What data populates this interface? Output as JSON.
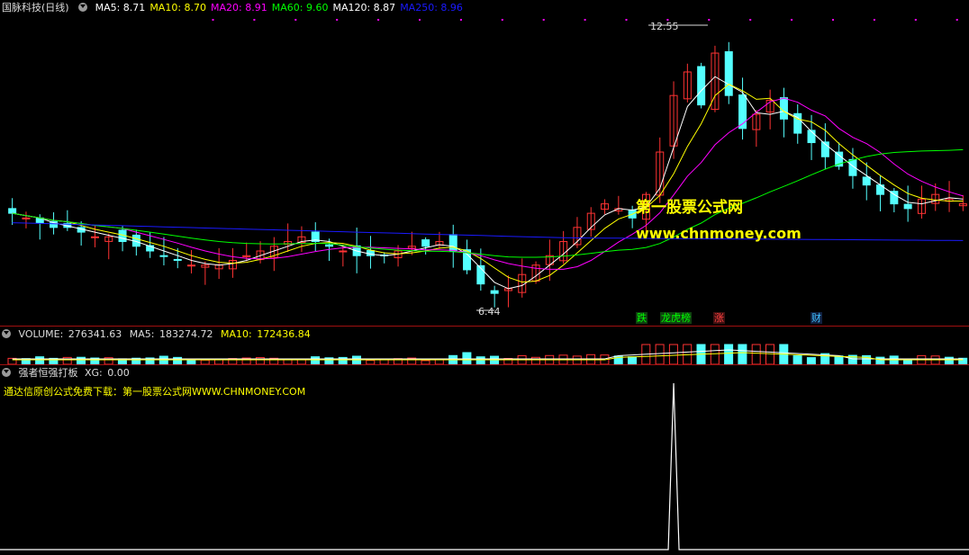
{
  "main_pane": {
    "title": "国脉科技(日线)",
    "ma": [
      {
        "label": "MA5:",
        "value": "8.71",
        "color": "#ffffff"
      },
      {
        "label": "MA10:",
        "value": "8.70",
        "color": "#ffff00"
      },
      {
        "label": "MA20:",
        "value": "8.91",
        "color": "#ff00ff"
      },
      {
        "label": "MA60:",
        "value": "9.60",
        "color": "#00ff00"
      },
      {
        "label": "MA120:",
        "value": "8.87",
        "color": "#ffffff"
      },
      {
        "label": "MA250:",
        "value": "8.96",
        "color": "#1a1aff"
      }
    ],
    "high_label": "12.55",
    "low_label": "6.44",
    "watermark_title": "第一股票公式网",
    "watermark_url": "www.chnmoney.com",
    "event_tags": [
      {
        "text": "跌",
        "color": "#00ff00",
        "bg": "#104010"
      },
      {
        "text": "龙虎榜",
        "color": "#00ff00",
        "bg": "#104010"
      },
      {
        "text": "涨",
        "color": "#ff4040",
        "bg": "#401010"
      },
      {
        "text": "财",
        "color": "#40c0ff",
        "bg": "#102040"
      }
    ]
  },
  "volume_pane": {
    "title": "VOLUME:",
    "value": "276341.63",
    "ma5_label": "MA5:",
    "ma5_value": "183274.72",
    "ma10_label": "MA10:",
    "ma10_value": "172436.84"
  },
  "indicator_pane": {
    "title": "强者恒强打板",
    "xg_label": "XG:",
    "xg_value": "0.00",
    "notice": "通达信原创公式免费下载：第一股票公式网WWW.CHNMONEY.COM"
  },
  "colors": {
    "up": "#ff3333",
    "down": "#54ffff",
    "ma5": "#ffffff",
    "ma10": "#ffff00",
    "ma20": "#ff00ff",
    "ma60": "#00ff00",
    "ma250": "#1a1aff",
    "separator": "#a01010"
  },
  "chart_data": {
    "type": "candlestick",
    "price_range": [
      6.44,
      12.55
    ],
    "close_path": [
      8.5,
      8.4,
      8.3,
      8.2,
      8.2,
      8.1,
      8.0,
      8.0,
      7.9,
      7.8,
      7.7,
      7.6,
      7.5,
      7.4,
      7.4,
      7.4,
      7.5,
      7.6,
      7.7,
      7.8,
      7.9,
      8.0,
      7.9,
      7.8,
      7.7,
      7.6,
      7.6,
      7.6,
      7.7,
      7.8,
      7.8,
      7.9,
      7.7,
      7.3,
      7.0,
      6.8,
      6.9,
      7.2,
      7.4,
      7.6,
      7.9,
      8.2,
      8.5,
      8.7,
      8.6,
      8.4,
      8.9,
      9.8,
      11.0,
      11.5,
      10.8,
      11.9,
      11.0,
      10.3,
      10.6,
      10.9,
      10.5,
      10.2,
      10.0,
      9.7,
      9.5,
      9.3,
      9.1,
      8.9,
      8.7,
      8.6,
      8.8,
      8.9,
      8.8,
      8.7
    ],
    "xg_signal_index": 48,
    "xg_range": [
      0,
      1
    ]
  }
}
